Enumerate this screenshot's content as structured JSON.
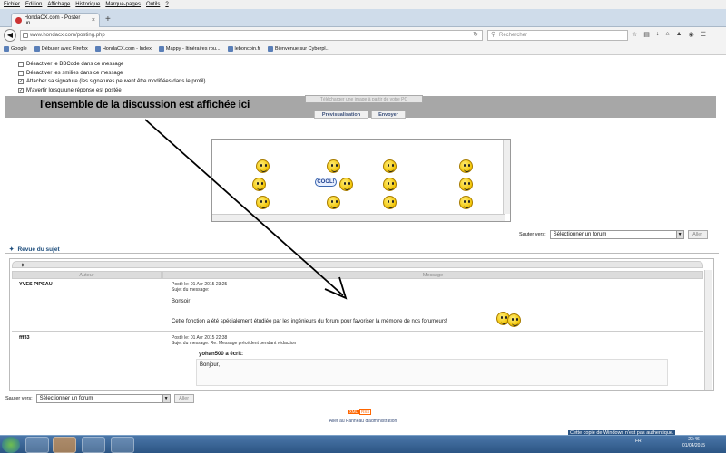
{
  "menu": [
    "Fichier",
    "Edition",
    "Affichage",
    "Historique",
    "Marque-pages",
    "Outils",
    "?"
  ],
  "tab": {
    "title": "HondaCX.com - Poster un...",
    "close": "×",
    "new": "+"
  },
  "navbar": {
    "url": "www.hondacx.com/posting.php",
    "search_placeholder": "Rechercher"
  },
  "bookmarks": [
    "Google",
    "Débuter avec Firefox",
    "HondaCX.com - Index",
    "Mappy - Itinéraires rou...",
    "leboncoin.fr",
    "Bienvenue sur Cyberpl..."
  ],
  "options": [
    {
      "label": "Désactiver le BBCode dans ce message",
      "checked": false
    },
    {
      "label": "Désactiver les smilies dans ce message",
      "checked": false
    },
    {
      "label": "Attacher sa signature (les signatures peuvent être modifiées dans le profil)",
      "checked": true
    },
    {
      "label": "M'avertir lorsqu'une réponse est postée",
      "checked": true
    }
  ],
  "annotation": "l'ensemble de la discussion est affichée ici",
  "upload_button": "Télécharger une image à partir de votre PC",
  "preview_button": "Prévisualisation",
  "send_button": "Envoyer",
  "smiley_cool": "COOL!",
  "jump": {
    "label": "Sauter vers:",
    "select": "Sélectionner un forum",
    "go": "Aller"
  },
  "review": {
    "title": "Revue du sujet",
    "col_author": "Auteur",
    "col_message": "Message",
    "posts": [
      {
        "author": "YVES PIPEAU",
        "posted": "Posté le: 01 Avr 2015 23:25",
        "subject": "Sujet du message:",
        "greeting": "Bonsoir",
        "text": "Cette fonction a été spécialement étudiée par les ingénieurs du forum pour favoriser la mémoire de nos forumeurs!"
      },
      {
        "author": "fff33",
        "posted": "Posté le: 01 Avr 2015 22:38",
        "subject": "Sujet du message: Re: Message précédent pendant rédaction",
        "quote_author": "yohan500 a écrit:",
        "text": "Bonjour,"
      }
    ]
  },
  "bottom_jump": {
    "label": "Sauter vers:",
    "select": "Sélectionner un forum",
    "go": "Aller"
  },
  "badge": {
    "xml": "XML",
    "rss": "RSS"
  },
  "footer": "Aller au Panneau d'administration",
  "taskbar": {
    "notice": "Cette copie de Windows n'est pas authentique.",
    "lang": "FR",
    "time": "23:46",
    "date": "01/04/2015"
  }
}
